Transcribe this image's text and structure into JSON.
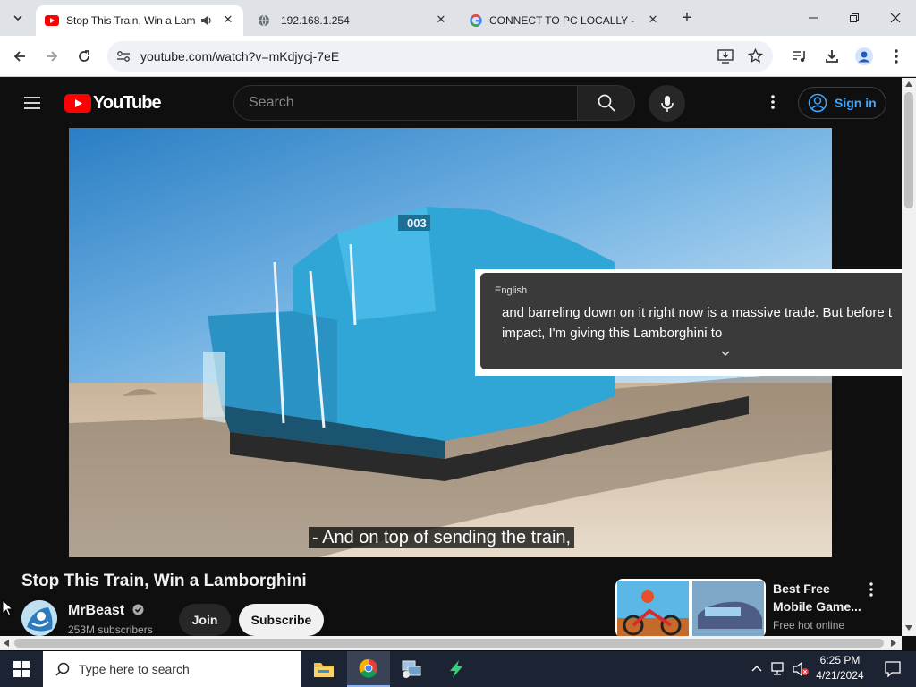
{
  "browser": {
    "tabs": [
      {
        "title": "Stop This Train, Win a Lam",
        "active": true
      },
      {
        "title": "192.168.1.254",
        "active": false
      },
      {
        "title": "CONNECT TO PC LOCALLY - G",
        "active": false
      }
    ],
    "url": "youtube.com/watch?v=mKdjycj-7eE"
  },
  "youtube": {
    "logo_text": "YouTube",
    "search_placeholder": "Search",
    "signin_label": "Sign in",
    "caption": "- And on top of sending the train,",
    "transcript": {
      "language": "English",
      "line1": "and barreling down on it right now is a massive trade. But before t",
      "line2": "impact, I'm giving this Lamborghini to"
    },
    "video_title": "Stop This Train, Win a Lamborghini",
    "channel": {
      "name": "MrBeast",
      "subscribers": "253M subscribers"
    },
    "join_label": "Join",
    "subscribe_label": "Subscribe",
    "recommendation": {
      "title": "Best Free Mobile Game...",
      "subtitle": "Free hot online"
    },
    "locomotive_number": "003"
  },
  "taskbar": {
    "search_placeholder": "Type here to search",
    "time": "6:25 PM",
    "date": "4/21/2024"
  }
}
